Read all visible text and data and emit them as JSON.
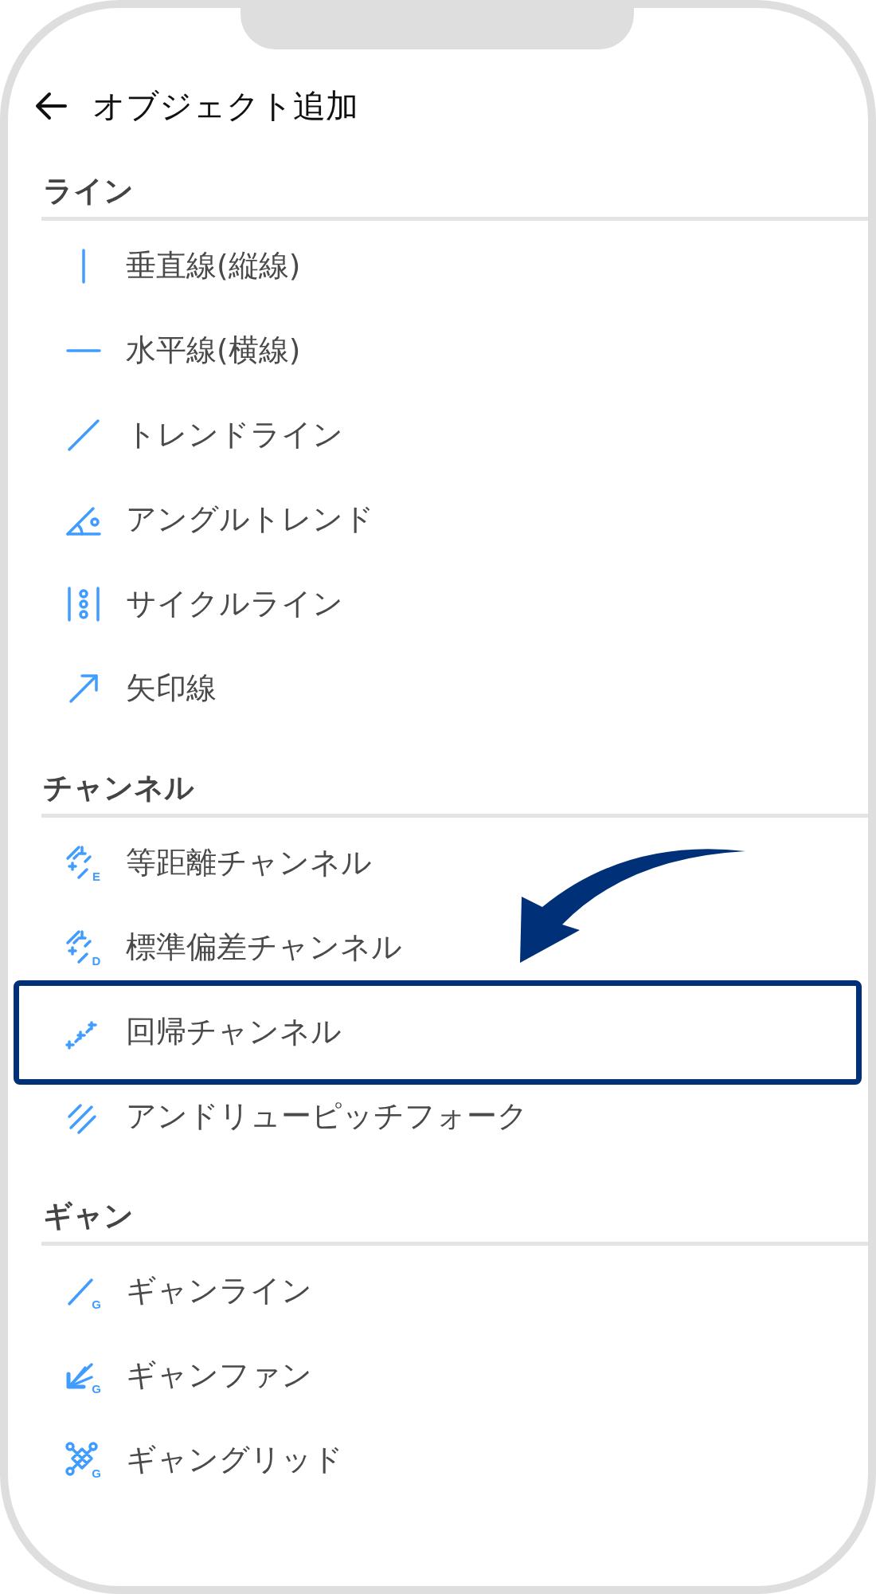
{
  "header": {
    "title": "オブジェクト追加"
  },
  "sections": [
    {
      "title": "ライン",
      "items": [
        {
          "label": "垂直線(縦線)",
          "highlighted": false
        },
        {
          "label": "水平線(横線)",
          "highlighted": false
        },
        {
          "label": "トレンドライン",
          "highlighted": false
        },
        {
          "label": "アングルトレンド",
          "highlighted": false
        },
        {
          "label": "サイクルライン",
          "highlighted": false
        },
        {
          "label": "矢印線",
          "highlighted": false
        }
      ]
    },
    {
      "title": "チャンネル",
      "items": [
        {
          "label": "等距離チャンネル",
          "badge": "E",
          "highlighted": false
        },
        {
          "label": "標準偏差チャンネル",
          "badge": "D",
          "highlighted": false
        },
        {
          "label": "回帰チャンネル",
          "highlighted": true
        },
        {
          "label": "アンドリューピッチフォーク",
          "highlighted": false
        }
      ]
    },
    {
      "title": "ギャン",
      "items": [
        {
          "label": "ギャンライン",
          "badge": "G",
          "highlighted": false
        },
        {
          "label": "ギャンファン",
          "badge": "G",
          "highlighted": false
        },
        {
          "label": "ギャングリッド",
          "badge": "G",
          "highlighted": false
        }
      ]
    }
  ]
}
